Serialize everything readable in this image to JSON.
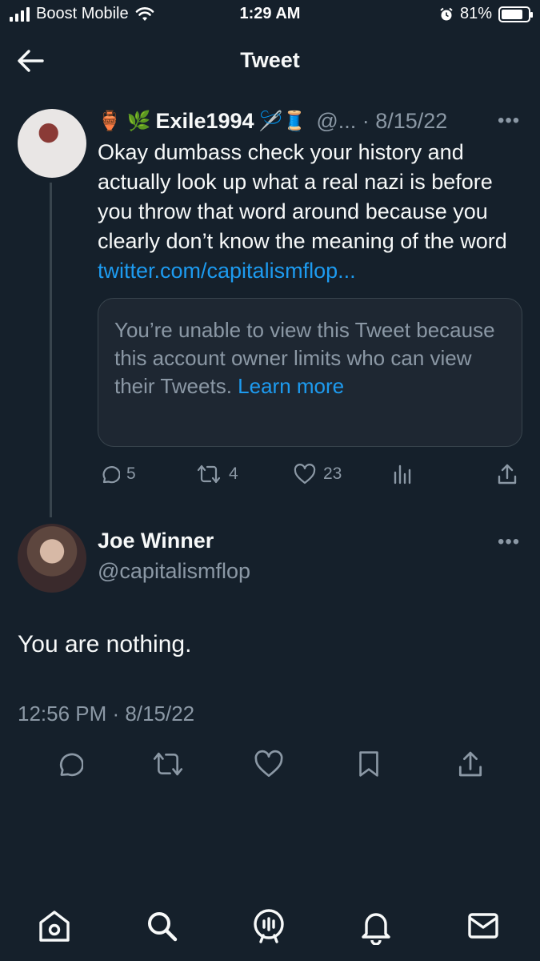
{
  "status_bar": {
    "carrier": "Boost Mobile",
    "time": "1:29 AM",
    "battery_text": "81%",
    "battery_level": 0.81
  },
  "header": {
    "title": "Tweet"
  },
  "quoted_tweet": {
    "emoji_prefix": "🏺 🌿",
    "display_name": "Exile1994",
    "emoji_suffix": "🪡🧵",
    "handle_date": "@... · 8/15/22",
    "body_text": "Okay dumbass check your history and actually look up what a real nazi is before you throw that word around because you clearly don’t know the meaning of the word",
    "link_text": "twitter.com/capitalismflop...",
    "unavailable_notice": "You’re unable to view this Tweet because this account owner limits who can view their Tweets.",
    "learn_more": "Learn more",
    "reply_count": "5",
    "retweet_count": "4",
    "like_count": "23",
    "more_label": "•••"
  },
  "main_tweet": {
    "display_name": "Joe Winner",
    "handle": "@capitalismflop",
    "text": "You are nothing.",
    "timestamp": "12:56 PM · 8/15/22",
    "more_label": "•••"
  },
  "icons": {
    "back": "arrow-left-icon",
    "reply": "reply-icon",
    "retweet": "retweet-icon",
    "like": "heart-icon",
    "views": "views-icon",
    "share": "share-icon",
    "bookmark": "bookmark-icon",
    "home": "home-icon",
    "search": "search-icon",
    "spaces": "spaces-icon",
    "notifications": "bell-icon",
    "messages": "mail-icon"
  },
  "colors": {
    "background": "#15202b",
    "accent": "#1d9bf0",
    "muted": "#8b98a5",
    "border": "#38444d"
  }
}
